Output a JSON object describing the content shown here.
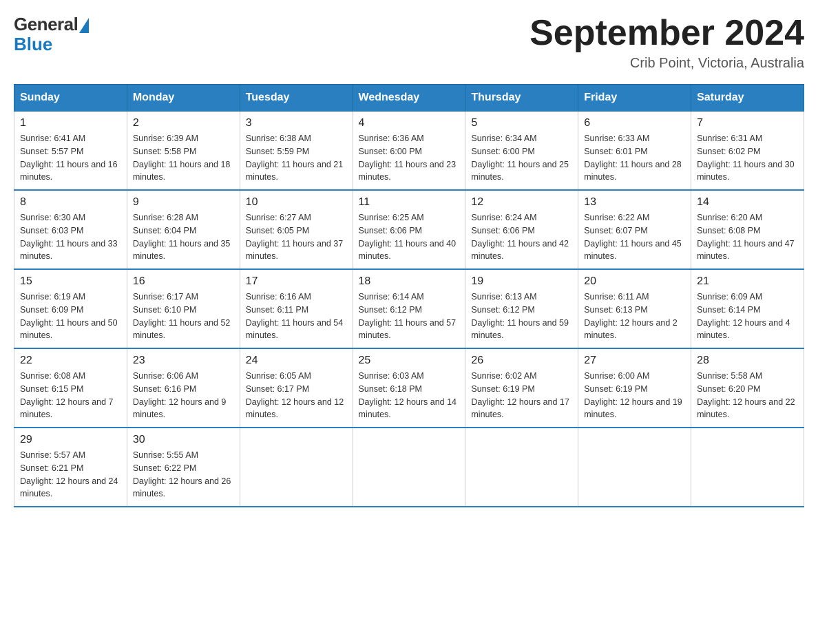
{
  "header": {
    "logo_general": "General",
    "logo_blue": "Blue",
    "title": "September 2024",
    "subtitle": "Crib Point, Victoria, Australia"
  },
  "weekdays": [
    "Sunday",
    "Monday",
    "Tuesday",
    "Wednesday",
    "Thursday",
    "Friday",
    "Saturday"
  ],
  "weeks": [
    [
      {
        "day": "1",
        "sunrise": "6:41 AM",
        "sunset": "5:57 PM",
        "daylight": "11 hours and 16 minutes."
      },
      {
        "day": "2",
        "sunrise": "6:39 AM",
        "sunset": "5:58 PM",
        "daylight": "11 hours and 18 minutes."
      },
      {
        "day": "3",
        "sunrise": "6:38 AM",
        "sunset": "5:59 PM",
        "daylight": "11 hours and 21 minutes."
      },
      {
        "day": "4",
        "sunrise": "6:36 AM",
        "sunset": "6:00 PM",
        "daylight": "11 hours and 23 minutes."
      },
      {
        "day": "5",
        "sunrise": "6:34 AM",
        "sunset": "6:00 PM",
        "daylight": "11 hours and 25 minutes."
      },
      {
        "day": "6",
        "sunrise": "6:33 AM",
        "sunset": "6:01 PM",
        "daylight": "11 hours and 28 minutes."
      },
      {
        "day": "7",
        "sunrise": "6:31 AM",
        "sunset": "6:02 PM",
        "daylight": "11 hours and 30 minutes."
      }
    ],
    [
      {
        "day": "8",
        "sunrise": "6:30 AM",
        "sunset": "6:03 PM",
        "daylight": "11 hours and 33 minutes."
      },
      {
        "day": "9",
        "sunrise": "6:28 AM",
        "sunset": "6:04 PM",
        "daylight": "11 hours and 35 minutes."
      },
      {
        "day": "10",
        "sunrise": "6:27 AM",
        "sunset": "6:05 PM",
        "daylight": "11 hours and 37 minutes."
      },
      {
        "day": "11",
        "sunrise": "6:25 AM",
        "sunset": "6:06 PM",
        "daylight": "11 hours and 40 minutes."
      },
      {
        "day": "12",
        "sunrise": "6:24 AM",
        "sunset": "6:06 PM",
        "daylight": "11 hours and 42 minutes."
      },
      {
        "day": "13",
        "sunrise": "6:22 AM",
        "sunset": "6:07 PM",
        "daylight": "11 hours and 45 minutes."
      },
      {
        "day": "14",
        "sunrise": "6:20 AM",
        "sunset": "6:08 PM",
        "daylight": "11 hours and 47 minutes."
      }
    ],
    [
      {
        "day": "15",
        "sunrise": "6:19 AM",
        "sunset": "6:09 PM",
        "daylight": "11 hours and 50 minutes."
      },
      {
        "day": "16",
        "sunrise": "6:17 AM",
        "sunset": "6:10 PM",
        "daylight": "11 hours and 52 minutes."
      },
      {
        "day": "17",
        "sunrise": "6:16 AM",
        "sunset": "6:11 PM",
        "daylight": "11 hours and 54 minutes."
      },
      {
        "day": "18",
        "sunrise": "6:14 AM",
        "sunset": "6:12 PM",
        "daylight": "11 hours and 57 minutes."
      },
      {
        "day": "19",
        "sunrise": "6:13 AM",
        "sunset": "6:12 PM",
        "daylight": "11 hours and 59 minutes."
      },
      {
        "day": "20",
        "sunrise": "6:11 AM",
        "sunset": "6:13 PM",
        "daylight": "12 hours and 2 minutes."
      },
      {
        "day": "21",
        "sunrise": "6:09 AM",
        "sunset": "6:14 PM",
        "daylight": "12 hours and 4 minutes."
      }
    ],
    [
      {
        "day": "22",
        "sunrise": "6:08 AM",
        "sunset": "6:15 PM",
        "daylight": "12 hours and 7 minutes."
      },
      {
        "day": "23",
        "sunrise": "6:06 AM",
        "sunset": "6:16 PM",
        "daylight": "12 hours and 9 minutes."
      },
      {
        "day": "24",
        "sunrise": "6:05 AM",
        "sunset": "6:17 PM",
        "daylight": "12 hours and 12 minutes."
      },
      {
        "day": "25",
        "sunrise": "6:03 AM",
        "sunset": "6:18 PM",
        "daylight": "12 hours and 14 minutes."
      },
      {
        "day": "26",
        "sunrise": "6:02 AM",
        "sunset": "6:19 PM",
        "daylight": "12 hours and 17 minutes."
      },
      {
        "day": "27",
        "sunrise": "6:00 AM",
        "sunset": "6:19 PM",
        "daylight": "12 hours and 19 minutes."
      },
      {
        "day": "28",
        "sunrise": "5:58 AM",
        "sunset": "6:20 PM",
        "daylight": "12 hours and 22 minutes."
      }
    ],
    [
      {
        "day": "29",
        "sunrise": "5:57 AM",
        "sunset": "6:21 PM",
        "daylight": "12 hours and 24 minutes."
      },
      {
        "day": "30",
        "sunrise": "5:55 AM",
        "sunset": "6:22 PM",
        "daylight": "12 hours and 26 minutes."
      },
      null,
      null,
      null,
      null,
      null
    ]
  ]
}
